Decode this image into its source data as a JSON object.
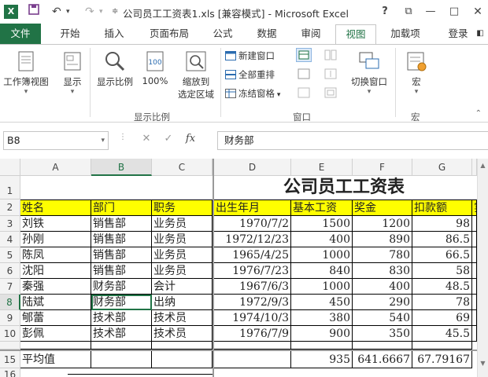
{
  "titlebar": {
    "logo": "X",
    "title": "公司员工工资表1.xls  [兼容模式] - Microsoft Excel",
    "help": "?",
    "restore": "⧉",
    "minimize": "—",
    "maximize": "□"
  },
  "tabs": {
    "file": "文件",
    "items": [
      "开始",
      "插入",
      "页面布局",
      "公式",
      "数据",
      "审阅",
      "视图",
      "加载项"
    ],
    "active": "视图",
    "login": "登录"
  },
  "ribbon": {
    "workbook_views": "工作簿视图",
    "show": "显示",
    "zoom": "显示比例",
    "zoom100": "100%",
    "zoom_selection_1": "缩放到",
    "zoom_selection_2": "选定区域",
    "zoom_group": "显示比例",
    "new_window": "新建窗口",
    "arrange_all": "全部重排",
    "freeze_panes": "冻结窗格",
    "window_group": "窗口",
    "switch_windows": "切换窗口",
    "macros": "宏",
    "macros_group": "宏"
  },
  "formulabar": {
    "namebox": "B8",
    "formula": "财务部",
    "fx": "fx"
  },
  "columns": [
    "A",
    "B",
    "C",
    "D",
    "E",
    "F",
    "G"
  ],
  "selected_cell": "B8",
  "sheet": {
    "title": "公司员工工资表",
    "headers": [
      "姓名",
      "部门",
      "职务",
      "出生年月",
      "基本工资",
      "奖金",
      "扣款额",
      "实"
    ],
    "rows": [
      {
        "num": "3",
        "cells": [
          "刘铁",
          "销售部",
          "业务员",
          "1970/7/2",
          "1500",
          "1200",
          "98"
        ]
      },
      {
        "num": "4",
        "cells": [
          "孙刚",
          "销售部",
          "业务员",
          "1972/12/23",
          "400",
          "890",
          "86.5"
        ]
      },
      {
        "num": "5",
        "cells": [
          "陈凤",
          "销售部",
          "业务员",
          "1965/4/25",
          "1000",
          "780",
          "66.5"
        ]
      },
      {
        "num": "6",
        "cells": [
          "沈阳",
          "销售部",
          "业务员",
          "1976/7/23",
          "840",
          "830",
          "58"
        ]
      },
      {
        "num": "7",
        "cells": [
          "秦强",
          "财务部",
          "会计",
          "1967/6/3",
          "1000",
          "400",
          "48.5"
        ]
      },
      {
        "num": "8",
        "cells": [
          "陆斌",
          "财务部",
          "出纳",
          "1972/9/3",
          "450",
          "290",
          "78"
        ]
      },
      {
        "num": "9",
        "cells": [
          "郇蕾",
          "技术部",
          "技术员",
          "1974/10/3",
          "380",
          "540",
          "69"
        ]
      },
      {
        "num": "10",
        "cells": [
          "彭佩",
          "技术部",
          "技术员",
          "1976/7/9",
          "900",
          "350",
          "45.5"
        ]
      }
    ],
    "avg_row": {
      "num": "15",
      "label": "平均值",
      "values": [
        "",
        "",
        "",
        "935",
        "641.6667",
        "67.79167"
      ]
    },
    "row16": "16"
  }
}
